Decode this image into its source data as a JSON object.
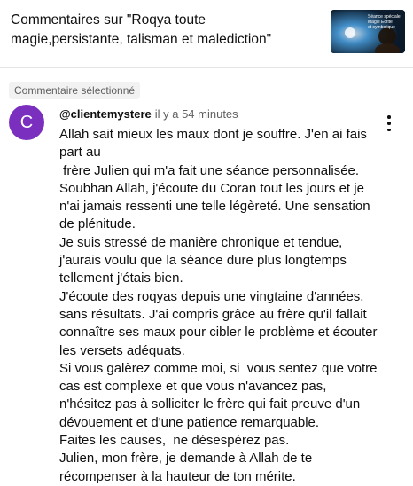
{
  "video": {
    "title": "Commentaires sur \"Roqya toute magie,persistante, talisman et malediction\"",
    "thumbnail_text": [
      "Séance spéciale",
      "Magie Ecrite",
      "et symbolique"
    ]
  },
  "selected_chip": "Commentaire sélectionné",
  "comment": {
    "avatar_letter": "C",
    "author": "@clientemystere",
    "time": "il y a 54 minutes",
    "text": "Allah sait mieux les maux dont je souffre. J'en ai fais part au\n frère Julien qui m'a fait une séance personnalisée.\nSoubhan Allah, j'écoute du Coran tout les jours et je n'ai jamais ressenti une telle légèreté. Une sensation de plénitude.\nJe suis stressé de manière chronique et tendue, j'aurais voulu que la séance dure plus longtemps tellement j'étais bien.\nJ'écoute des roqyas depuis une vingtaine d'années, sans résultats. J'ai compris grâce au frère qu'il fallait connaître ses maux pour cibler le problème et écouter les versets adéquats.\nSi vous galèrez comme moi, si  vous sentez que votre cas est complexe et que vous n'avancez pas, n'hésitez pas à solliciter le frère qui fait preuve d'un dévouement et d'une patience remarquable.\nFaites les causes,  ne désespérez pas.\nJulien, mon frère, je demande à Allah de te récompenser à la hauteur de ton mérite."
  },
  "colors": {
    "avatar": "#7b2fbe",
    "chip_bg": "#f2f2f2",
    "secondary_text": "#606060"
  },
  "icons": {
    "more": "more-vert-icon"
  }
}
